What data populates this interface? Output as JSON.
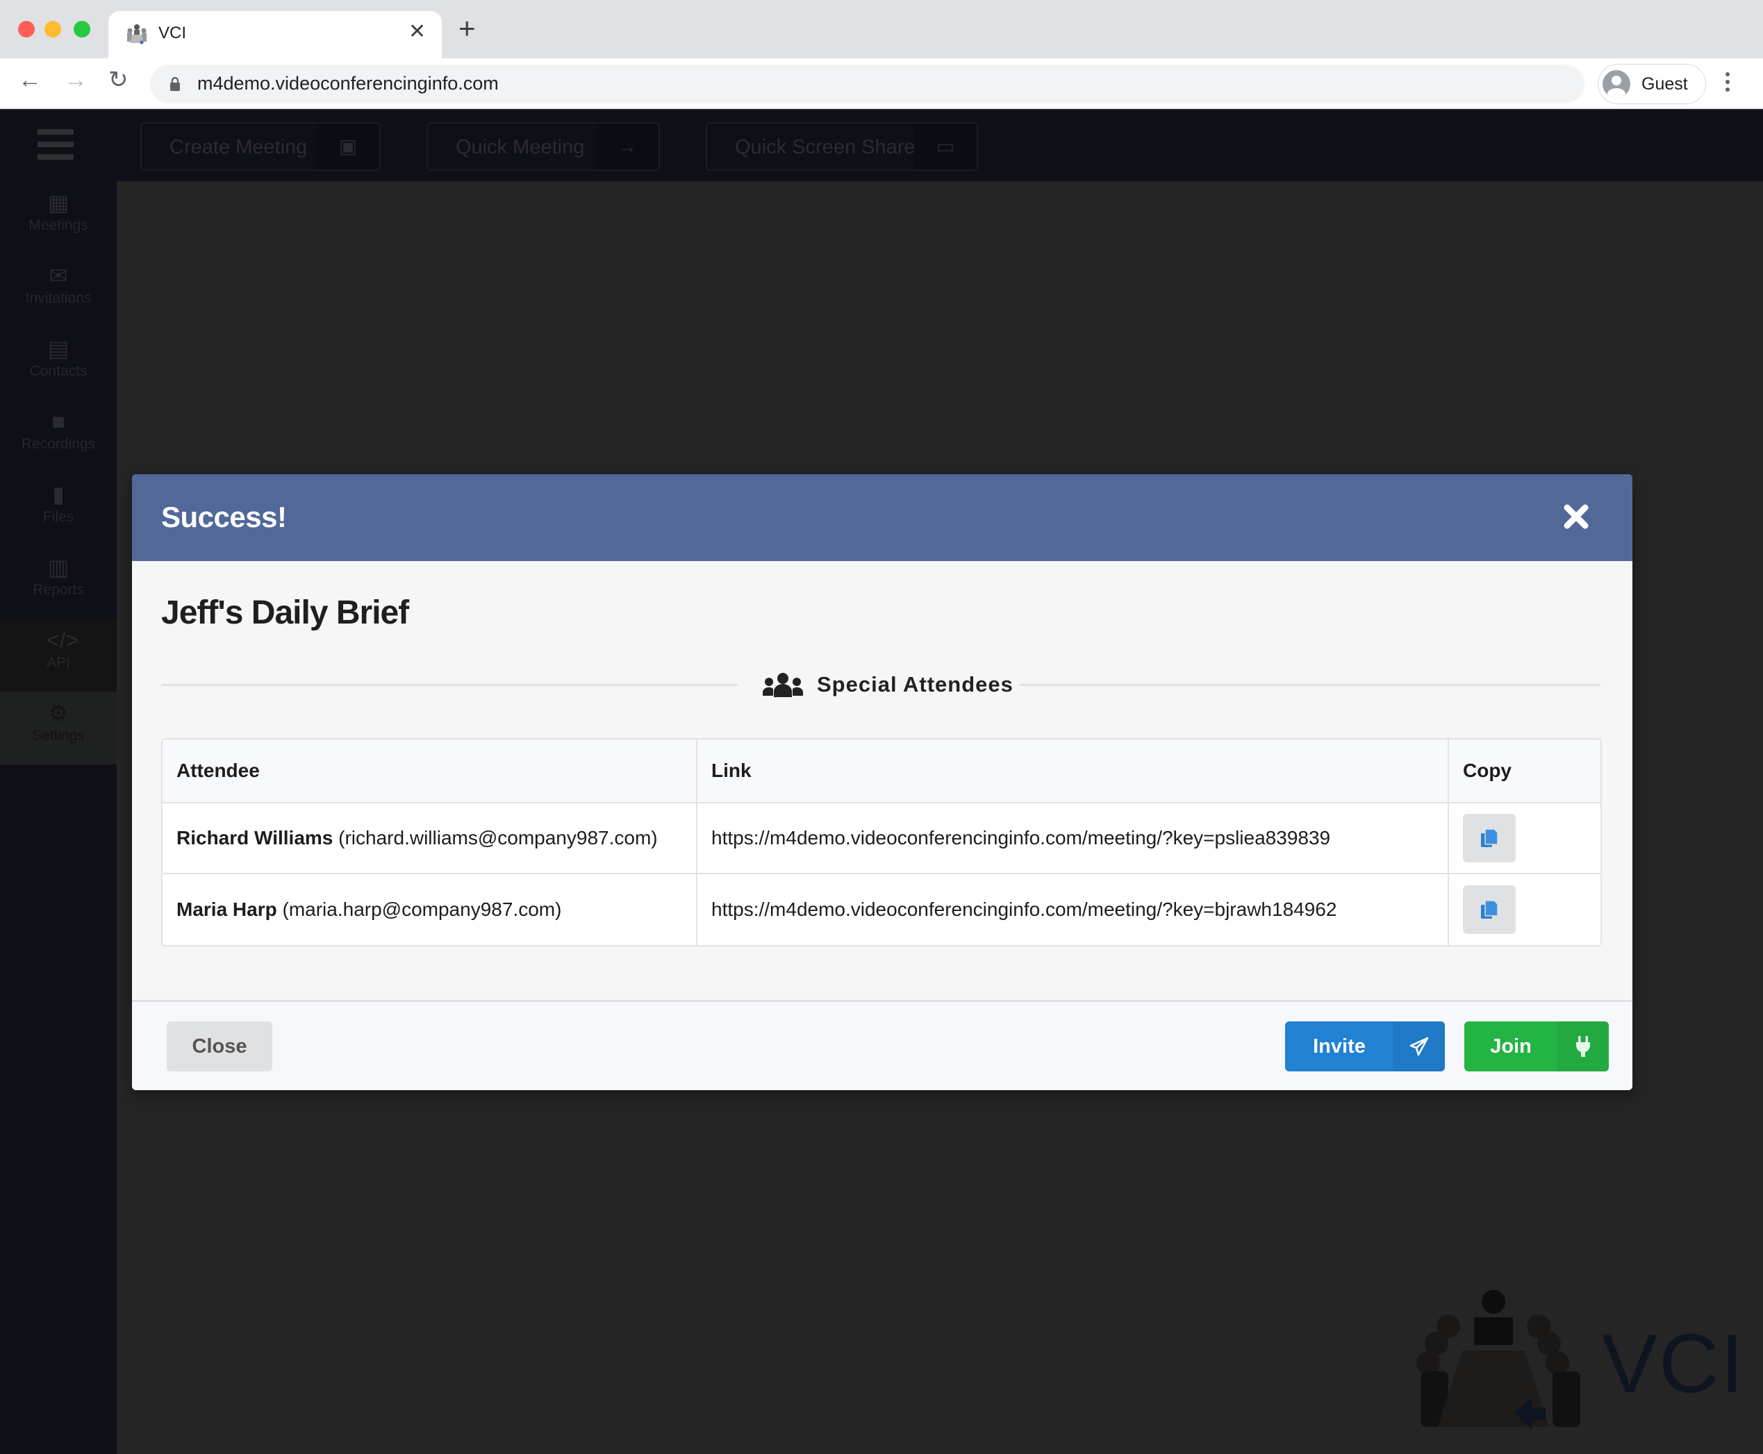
{
  "browser": {
    "tab_title": "VCI",
    "url": "m4demo.videoconferencinginfo.com",
    "profile_label": "Guest"
  },
  "app": {
    "header_buttons": [
      {
        "label": "Create Meeting",
        "icon": "calendar-plus-icon"
      },
      {
        "label": "Quick Meeting",
        "icon": "arrow-right-icon"
      },
      {
        "label": "Quick Screen Share",
        "icon": "desktop-icon"
      }
    ],
    "sidebar": [
      {
        "label": "Meetings",
        "icon": "calendar-icon"
      },
      {
        "label": "Invitations",
        "icon": "envelope-icon"
      },
      {
        "label": "Contacts",
        "icon": "address-book-icon"
      },
      {
        "label": "Recordings",
        "icon": "video-icon"
      },
      {
        "label": "Files",
        "icon": "file-icon"
      },
      {
        "label": "Reports",
        "icon": "bar-chart-icon"
      },
      {
        "label": "API",
        "icon": "code-icon"
      },
      {
        "label": "Settings",
        "icon": "gears-icon"
      }
    ],
    "logo_text": "VCI"
  },
  "modal": {
    "title": "Success!",
    "meeting_name": "Jeff's Daily Brief",
    "section_title": "Special Attendees",
    "table": {
      "headers": [
        "Attendee",
        "Link",
        "Copy"
      ],
      "rows": [
        {
          "name": "Richard Williams",
          "email": "(richard.williams@company987.com)",
          "link": "https://m4demo.videoconferencinginfo.com/meeting/?key=psliea839839"
        },
        {
          "name": "Maria Harp",
          "email": "(maria.harp@company987.com)",
          "link": "https://m4demo.videoconferencinginfo.com/meeting/?key=bjrawh184962"
        }
      ]
    },
    "footer": {
      "close_label": "Close",
      "invite_label": "Invite",
      "join_label": "Join"
    },
    "colors": {
      "header": "#516899",
      "invite": "#2181d2",
      "join": "#24b444"
    }
  }
}
